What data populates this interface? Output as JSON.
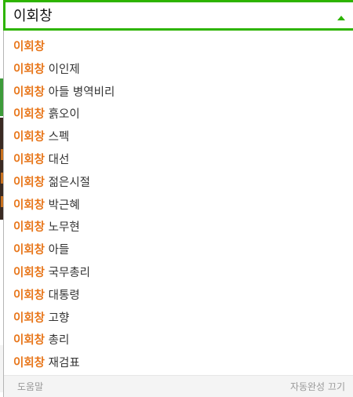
{
  "search": {
    "query": "이회창"
  },
  "suggestions": [
    {
      "highlight": "이회창",
      "rest": ""
    },
    {
      "highlight": "이회창",
      "rest": " 이인제"
    },
    {
      "highlight": "이회창",
      "rest": " 아들 병역비리"
    },
    {
      "highlight": "이회창",
      "rest": " 흙오이"
    },
    {
      "highlight": "이회창",
      "rest": " 스펙"
    },
    {
      "highlight": "이회창",
      "rest": " 대선"
    },
    {
      "highlight": "이회창",
      "rest": " 젊은시절"
    },
    {
      "highlight": "이회창",
      "rest": " 박근혜"
    },
    {
      "highlight": "이회창",
      "rest": " 노무현"
    },
    {
      "highlight": "이회창",
      "rest": " 아들"
    },
    {
      "highlight": "이회창",
      "rest": " 국무총리"
    },
    {
      "highlight": "이회창",
      "rest": " 대통령"
    },
    {
      "highlight": "이회창",
      "rest": " 고향"
    },
    {
      "highlight": "이회창",
      "rest": " 총리"
    },
    {
      "highlight": "이회창",
      "rest": " 재검표"
    }
  ],
  "footer": {
    "help_label": "도움말",
    "autocomplete_off_label": "자동완성 끄기"
  },
  "colors": {
    "accent": "#2db400",
    "highlight": "#e8761a"
  },
  "icons": {
    "collapse": "arrow-up-icon"
  }
}
